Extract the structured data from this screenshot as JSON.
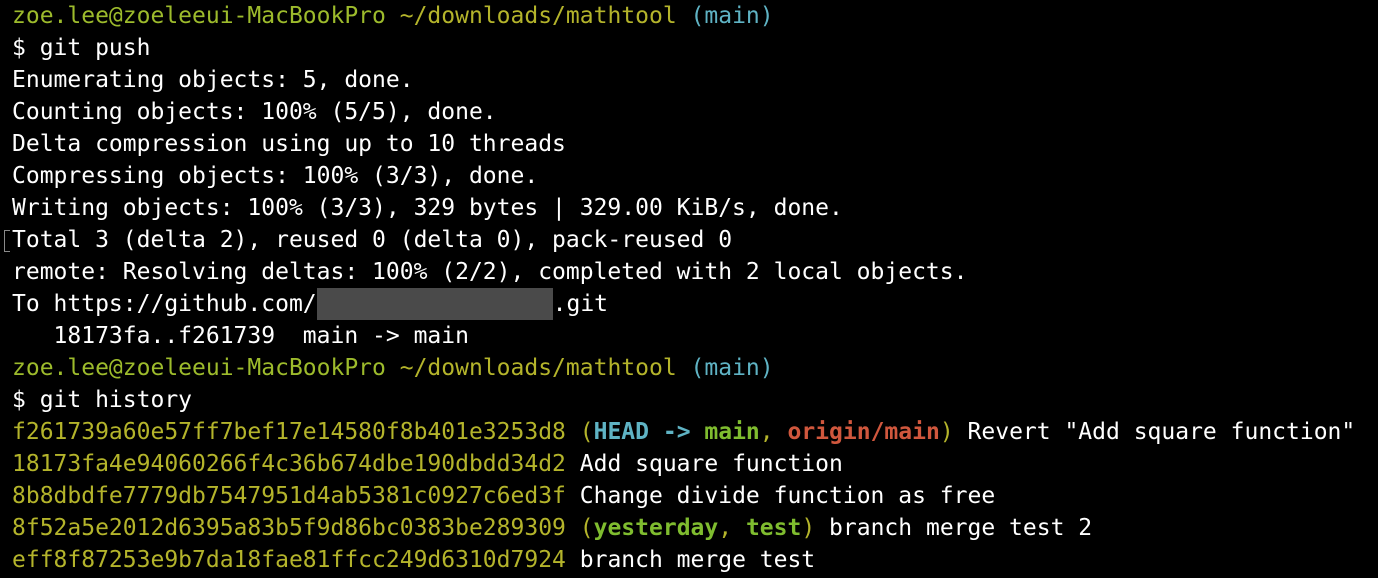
{
  "prompt1": {
    "user_host": "zoe.lee@zoeleeui-MacBookPro",
    "path": "~/downloads/mathtool",
    "branch": "(main)"
  },
  "cmd1": "$ git push",
  "push_output": [
    "Enumerating objects: 5, done.",
    "Counting objects: 100% (5/5), done.",
    "Delta compression using up to 10 threads",
    "Compressing objects: 100% (3/3), done.",
    "Writing objects: 100% (3/3), 329 bytes | 329.00 KiB/s, done.",
    "Total 3 (delta 2), reused 0 (delta 0), pack-reused 0",
    "remote: Resolving deltas: 100% (2/2), completed with 2 local objects."
  ],
  "push_to": {
    "prefix": "To https://github.com/",
    "suffix": ".git"
  },
  "push_ref": "   18173fa..f261739  main -> main",
  "prompt2": {
    "user_host": "zoe.lee@zoeleeui-MacBookPro",
    "path": "~/downloads/mathtool",
    "branch": "(main)"
  },
  "cmd2": "$ git history",
  "history": [
    {
      "hash": "f261739a60e57ff7bef17e14580f8b401e3253d8",
      "refs": {
        "open": "(",
        "head": "HEAD -> ",
        "branch": "main",
        "sep": ", ",
        "origin": "origin/main",
        "close": ")"
      },
      "message": "Revert \"Add square function\""
    },
    {
      "hash": "18173fa4e94060266f4c36b674dbe190dbdd34d2",
      "message": "Add square function"
    },
    {
      "hash": "8b8dbdfe7779db7547951d4ab5381c0927c6ed3f",
      "message": "Change divide function as free"
    },
    {
      "hash": "8f52a5e2012d6395a83b5f9d86bc0383be289309",
      "refs": {
        "open": "(",
        "b1": "yesterday",
        "sep": ", ",
        "b2": "test",
        "close": ")"
      },
      "message": "branch merge test 2"
    },
    {
      "hash": "eff8f87253e9b7da18fae81ffcc249d6310d7924",
      "message": "branch merge test"
    }
  ],
  "colors": {
    "background": "#000000",
    "user_host": "#9dbb2c",
    "path": "#b4b42b",
    "branch": "#5fb3c4",
    "hash": "#b4b42b",
    "head_ref": "#5fb3c4",
    "local_branch": "#7fbc2f",
    "remote_branch": "#d0573d"
  }
}
